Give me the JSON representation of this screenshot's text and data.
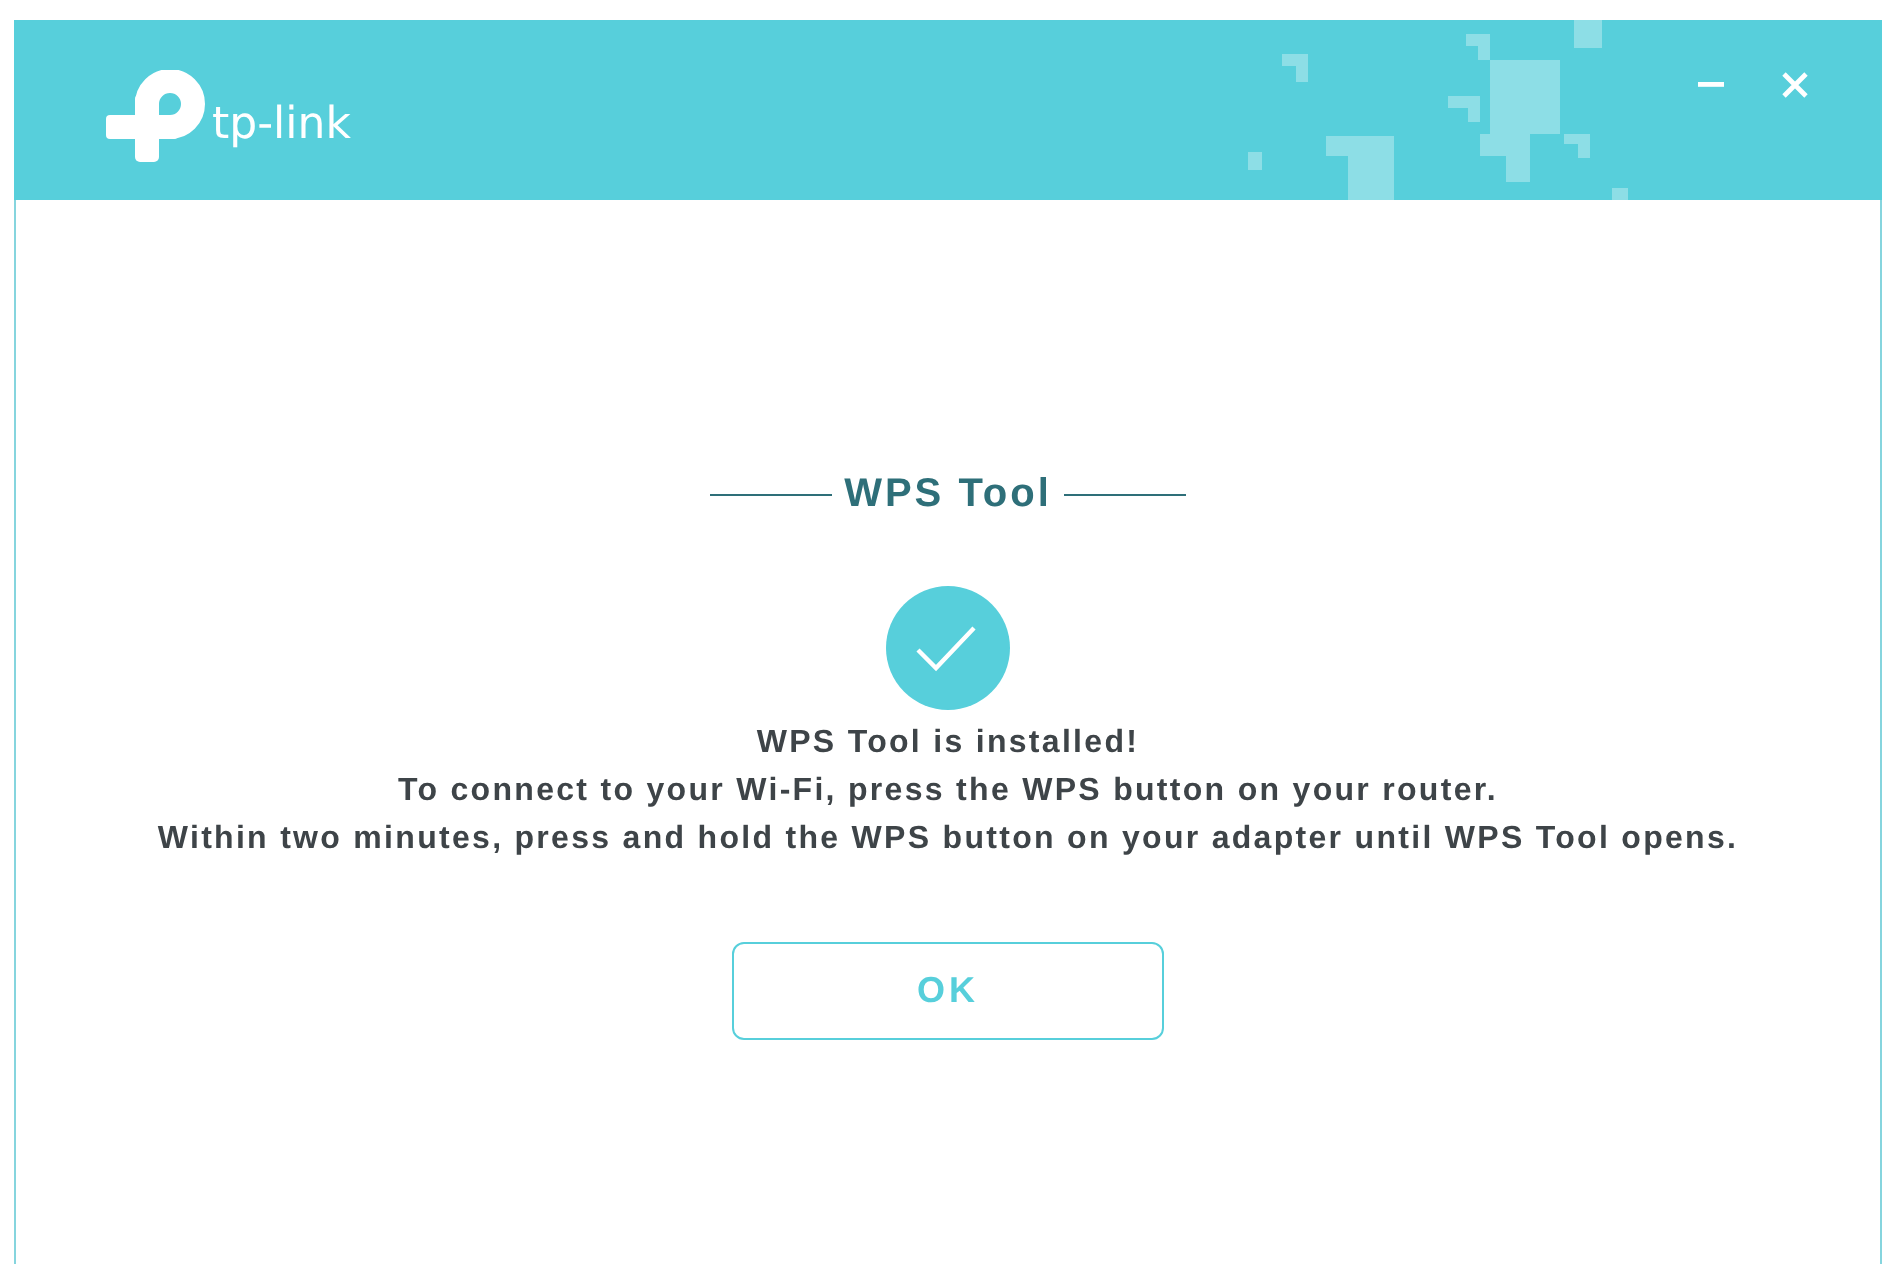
{
  "header": {
    "logo_text": "tp-link",
    "window_controls": [
      {
        "kind": "minimize"
      },
      {
        "kind": "close"
      }
    ]
  },
  "dialog": {
    "title": "WPS Tool",
    "message_lines": [
      "WPS Tool is installed!",
      "To connect to your Wi-Fi, press the WPS button on your router.",
      "Within two minutes, press and hold the WPS button on your adapter until WPS Tool opens."
    ],
    "button": {
      "label": "OK"
    }
  }
}
